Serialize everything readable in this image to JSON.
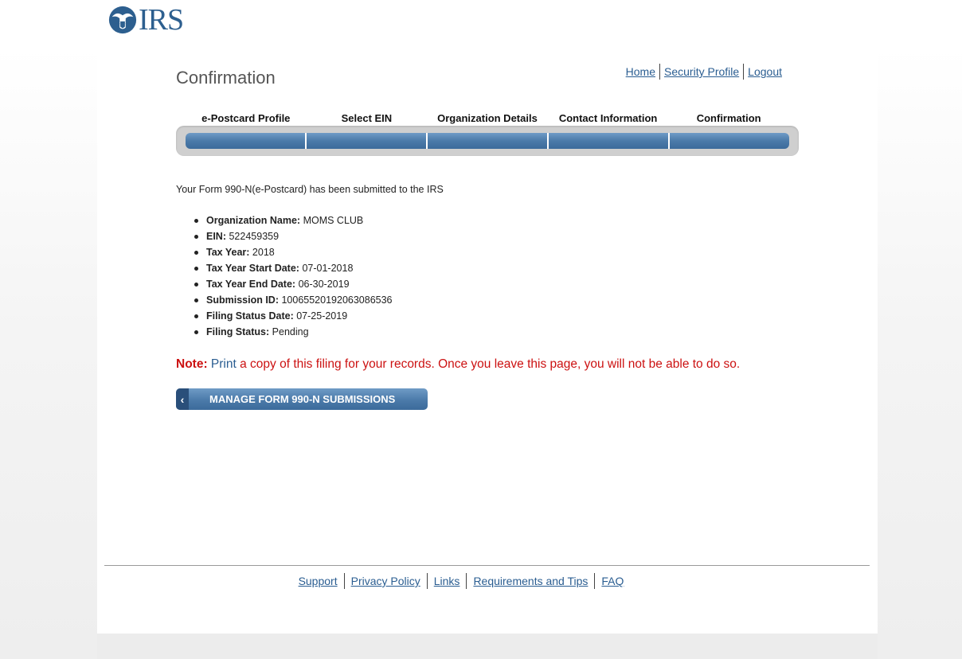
{
  "brand": {
    "logo_text": "IRS",
    "emblem_icon": "irs-eagle-emblem-icon",
    "color": "#2d5f8f"
  },
  "page": {
    "title": "Confirmation"
  },
  "top_nav": {
    "items": [
      "Home",
      "Security Profile",
      "Logout"
    ]
  },
  "steps": {
    "labels": [
      "e-Postcard Profile",
      "Select EIN",
      "Organization Details",
      "Contact Information",
      "Confirmation"
    ],
    "completed": 5,
    "total": 5
  },
  "confirmation": {
    "intro": "Your Form 990-N(e-Postcard) has been submitted to the IRS",
    "details": [
      {
        "label": "Organization Name:",
        "value": "MOMS CLUB"
      },
      {
        "label": "EIN:",
        "value": "522459359"
      },
      {
        "label": "Tax Year:",
        "value": "2018"
      },
      {
        "label": "Tax Year Start Date:",
        "value": "07-01-2018"
      },
      {
        "label": "Tax Year End Date:",
        "value": "06-30-2019"
      },
      {
        "label": "Submission ID:",
        "value": "10065520192063086536"
      },
      {
        "label": "Filing Status Date:",
        "value": "07-25-2019"
      },
      {
        "label": "Filing Status:",
        "value": "Pending"
      }
    ],
    "note": {
      "label": "Note:",
      "print_link": "Print",
      "text": "a copy of this filing for your records. Once you leave this page, you will not be able to do so."
    }
  },
  "actions": {
    "manage_label": "MANAGE FORM 990-N SUBMISSIONS",
    "manage_icon": "chevron-left-icon"
  },
  "footer": {
    "links": [
      "Support",
      "Privacy Policy",
      "Links",
      "Requirements and Tips",
      "FAQ"
    ]
  },
  "colors": {
    "link": "#2a5d91",
    "note_red": "#cc1111",
    "button_blue": "#4b7aa9"
  }
}
